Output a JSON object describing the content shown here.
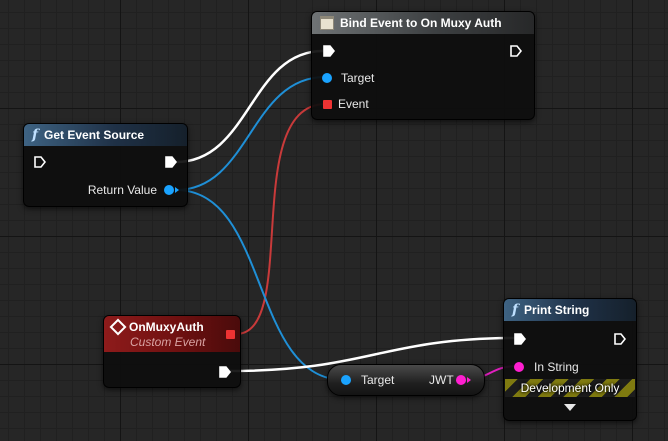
{
  "nodes": {
    "get_event_source": {
      "title": "Get Event Source",
      "return_value_label": "Return Value"
    },
    "bind_event": {
      "title": "Bind Event to On Muxy Auth",
      "target_label": "Target",
      "event_label": "Event"
    },
    "on_muxy_auth": {
      "title": "OnMuxyAuth",
      "subtitle": "Custom Event"
    },
    "get_jwt": {
      "target_label": "Target",
      "output_label": "JWT"
    },
    "print_string": {
      "title": "Print String",
      "in_string_label": "In String",
      "dev_only_label": "Development Only"
    }
  },
  "colors": {
    "exec_wire": "#ffffff",
    "object_pin": "#1aa3ff",
    "delegate_pin": "#ff3b3b",
    "string_pin": "#ff1fd0"
  }
}
